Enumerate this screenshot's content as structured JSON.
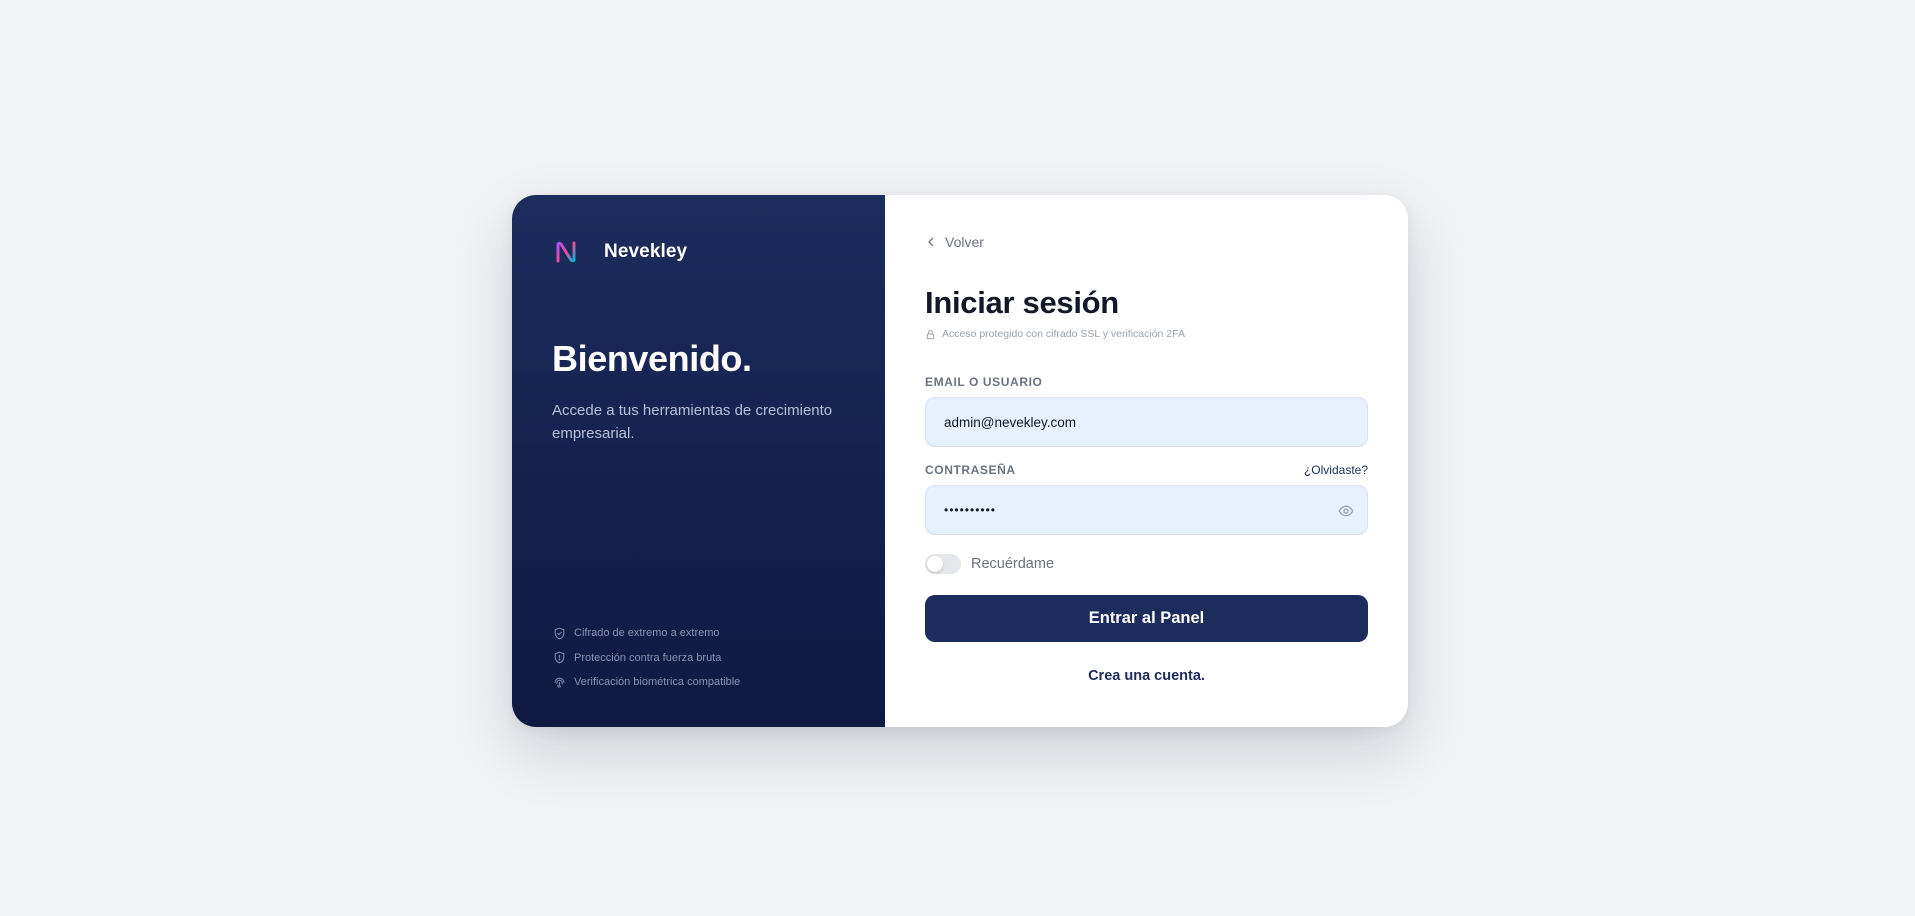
{
  "brand": {
    "name": "Nevekley",
    "logo_icon": "n-logo-icon"
  },
  "hero": {
    "title": "Bienvenido.",
    "subtitle": "Accede a tus herramientas de crecimiento empresarial."
  },
  "features": [
    {
      "icon": "shield-check-icon",
      "label": "Cifrado de extremo a extremo"
    },
    {
      "icon": "shield-icon",
      "label": "Protección contra fuerza bruta"
    },
    {
      "icon": "fingerprint-icon",
      "label": "Verificación biométrica compatible"
    }
  ],
  "form": {
    "back_label": "Volver",
    "title": "Iniciar sesión",
    "security_note": "Acceso protegido con cifrado SSL y verificación 2FA",
    "email_label": "EMAIL O USUARIO",
    "email_value": "admin@nevekley.com",
    "password_label": "CONTRASEÑA",
    "forgot_label": "¿Olvidaste?",
    "password_value": "••••••••••",
    "remember_label": "Recuérdame",
    "remember_checked": false,
    "submit_label": "Entrar al Panel",
    "create_account_label": "Crea una cuenta."
  },
  "colors": {
    "page_bg": "#f2f3f5",
    "panel_dark": "#1c2c5c",
    "input_bg": "#e8f0fe",
    "primary_button": "#1c2c5c",
    "logo_gradient": [
      "#7c3aed",
      "#ec4899",
      "#06b6d4"
    ]
  }
}
